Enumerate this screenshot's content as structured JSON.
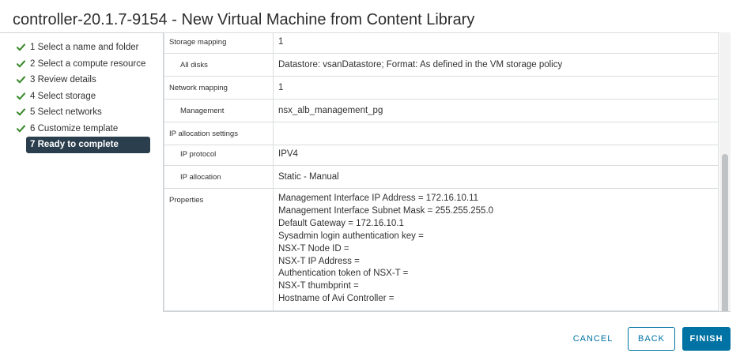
{
  "window": {
    "title": "controller-20.1.7-9154 - New Virtual Machine from Content Library"
  },
  "colors": {
    "check": "#3d8c2f",
    "active_step_bg": "#2a3e4d",
    "primary": "#0072a3"
  },
  "steps": [
    {
      "label": "1 Select a name and folder",
      "done": true,
      "icon": "check-icon"
    },
    {
      "label": "2 Select a compute resource",
      "done": true,
      "icon": "check-icon"
    },
    {
      "label": "3 Review details",
      "done": true,
      "icon": "check-icon"
    },
    {
      "label": "4 Select storage",
      "done": true,
      "icon": "check-icon"
    },
    {
      "label": "5 Select networks",
      "done": true,
      "icon": "check-icon"
    },
    {
      "label": "6 Customize template",
      "done": true,
      "icon": "check-icon"
    },
    {
      "label": "7 Ready to complete",
      "done": false,
      "active": true
    }
  ],
  "summary": {
    "storage_mapping": {
      "label": "Storage mapping",
      "value": "1"
    },
    "all_disks": {
      "label": "All disks",
      "value": "Datastore: vsanDatastore; Format: As defined in the VM storage policy"
    },
    "network_mapping": {
      "label": "Network mapping",
      "value": "1"
    },
    "management": {
      "label": "Management",
      "value": "nsx_alb_management_pg"
    },
    "ip_allocation_settings": {
      "label": "IP allocation settings",
      "value": ""
    },
    "ip_protocol": {
      "label": "IP protocol",
      "value": "IPV4"
    },
    "ip_allocation": {
      "label": "IP allocation",
      "value": "Static - Manual"
    },
    "properties": {
      "label": "Properties",
      "lines": [
        "Management Interface IP Address = 172.16.10.11",
        "Management Interface Subnet Mask = 255.255.255.0",
        "Default Gateway = 172.16.10.1",
        "Sysadmin login authentication key =",
        "NSX-T Node ID =",
        "NSX-T IP Address =",
        "Authentication token of NSX-T =",
        "NSX-T thumbprint =",
        "Hostname of Avi Controller ="
      ]
    }
  },
  "footer": {
    "cancel_label": "CANCEL",
    "back_label": "BACK",
    "finish_label": "FINISH"
  }
}
